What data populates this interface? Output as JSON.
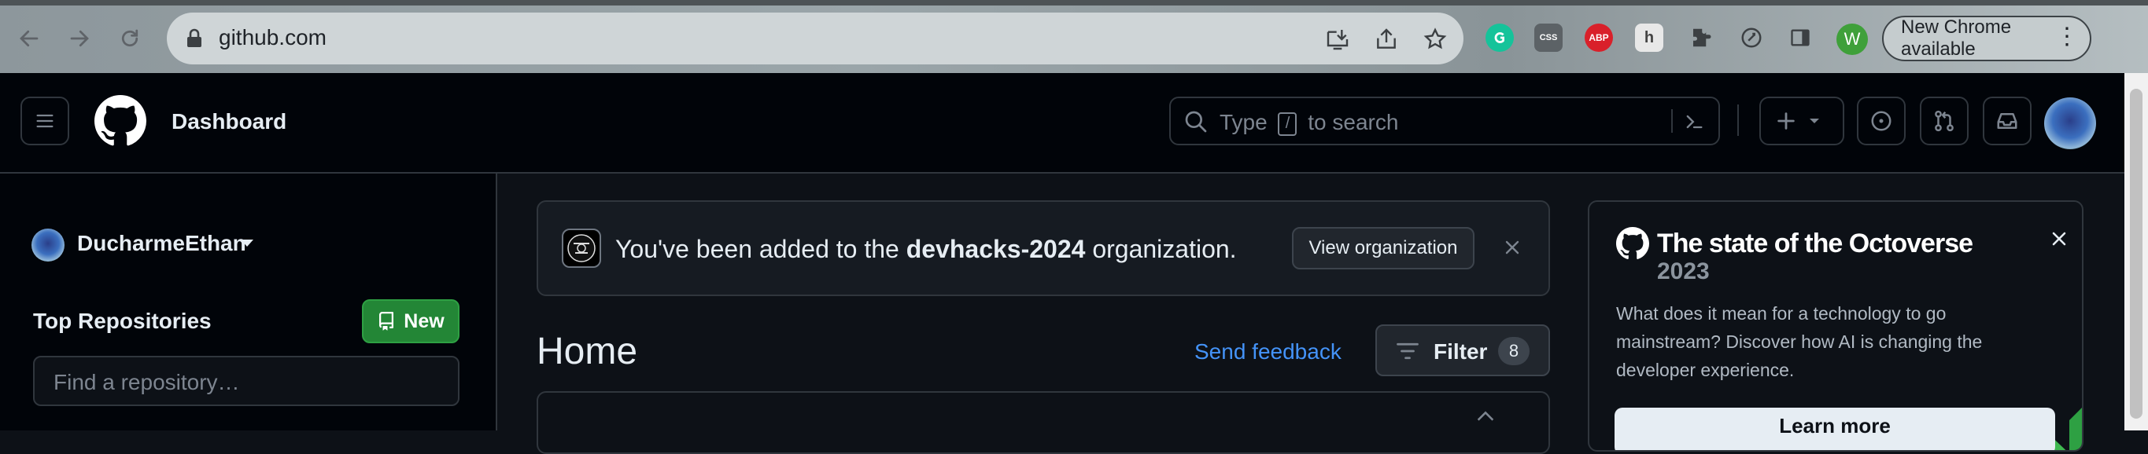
{
  "browser": {
    "url": "github.com",
    "extensions": [
      "grammarly-icon",
      "css-icon",
      "adblock-plus-icon",
      "honey-icon",
      "puzzle-icon",
      "performance-icon"
    ],
    "profile_initial": "W",
    "update_label": "New Chrome available",
    "colors": {
      "toolbar": "#9aa5a9",
      "omnibox": "#cfd5d7",
      "profile": "#3fa03a"
    }
  },
  "header": {
    "title": "Dashboard",
    "search": {
      "placeholder_before": "Type",
      "slash_key": "/",
      "placeholder_after": "to search"
    }
  },
  "sidebar": {
    "context_user": "DucharmeEthan",
    "top_repos_title": "Top Repositories",
    "new_button": "New",
    "find_placeholder": "Find a repository…"
  },
  "notice": {
    "text_before": "You've been added to the",
    "org_name": "devhacks-2024",
    "text_after": "organization.",
    "action_label": "View organization"
  },
  "main": {
    "title": "Home",
    "feedback_link": "Send feedback",
    "filter_label": "Filter",
    "filter_count": "8"
  },
  "octoverse": {
    "title": "The state of the Octoverse",
    "year": "2023",
    "description": "What does it mean for a technology to go mainstream? Discover how AI is changing the developer experience.",
    "cta": "Learn more"
  },
  "colors": {
    "page_bg": "#0d1117",
    "header_bg": "#010409",
    "border": "#30363d",
    "accent_link": "#4493f8",
    "primary_button": "#238636"
  }
}
